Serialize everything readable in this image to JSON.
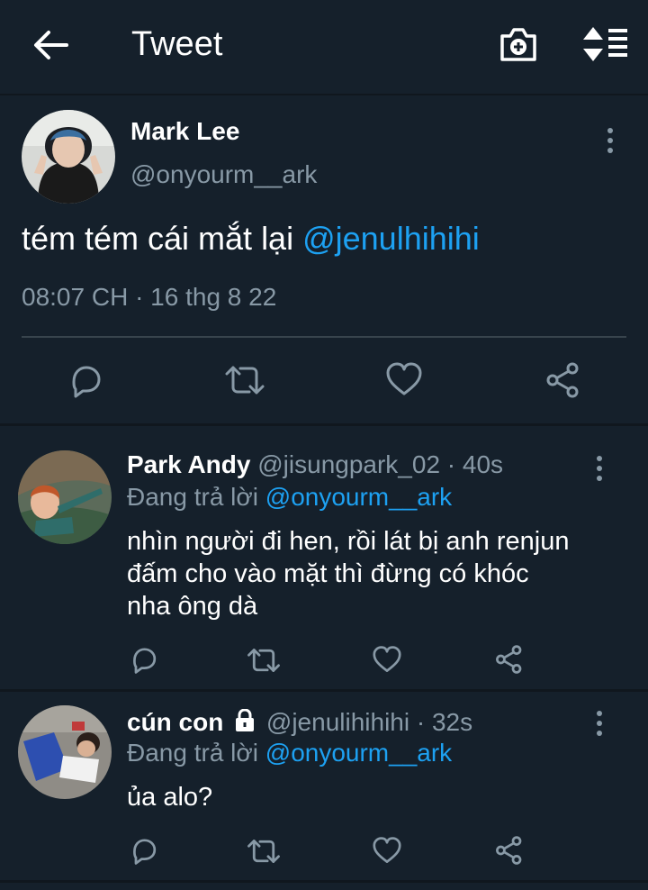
{
  "header": {
    "title": "Tweet"
  },
  "main_tweet": {
    "author_name": "Mark Lee",
    "author_handle": "@onyourm__ark",
    "text_before": "tém tém cái mắt lại ",
    "text_mention": "@jenulhihihi",
    "timestamp": "08:07 CH · 16 thg 8 22"
  },
  "replies": [
    {
      "author_name": "Park Andy",
      "meta": "@jisungpark_02 · 40s",
      "replying_prefix": "Đang trả lời ",
      "replying_to": "@onyourm__ark",
      "text_lines": [
        "nhìn người đi hen, rồi lát bị anh renjun",
        "đấm cho vào mặt thì đừng có khóc",
        "nha ông dà"
      ],
      "protected": false
    },
    {
      "author_name": "cún con",
      "meta": "@jenulihihihi · 32s",
      "replying_prefix": "Đang trả lời ",
      "replying_to": "@onyourm__ark",
      "text_lines": [
        "ủa alo?"
      ],
      "protected": true
    }
  ],
  "icons": [
    "back-arrow-icon",
    "camera-plus-icon",
    "sort-icon",
    "more-vert-icon",
    "reply-icon",
    "retweet-icon",
    "like-icon",
    "share-icon",
    "lock-icon"
  ],
  "colors": {
    "background": "#15202b",
    "accent": "#1da1f2",
    "secondary_text": "#8899a6",
    "divider": "#38444d"
  }
}
